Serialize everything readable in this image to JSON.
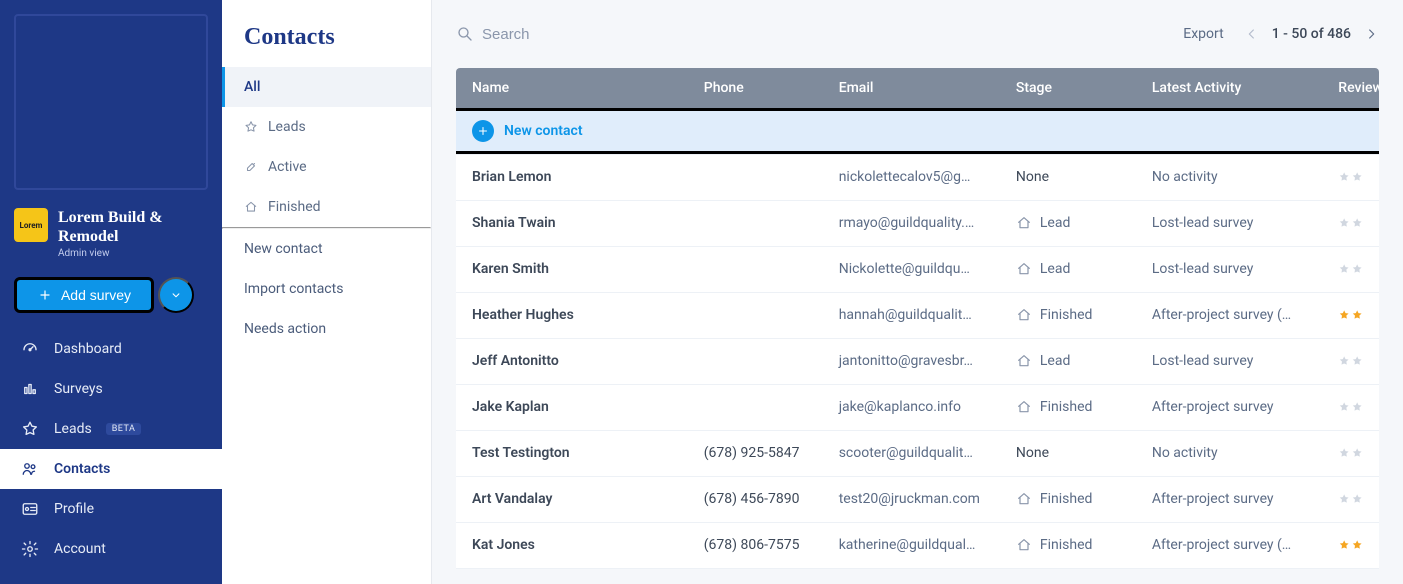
{
  "sidebar": {
    "company_name": "Lorem Build & Remodel",
    "admin_view": "Admin view",
    "avatar_label": "Lorem",
    "add_survey_label": "Add survey",
    "nav": [
      {
        "key": "dashboard",
        "label": "Dashboard",
        "icon": "gauge-icon"
      },
      {
        "key": "surveys",
        "label": "Surveys",
        "icon": "bar-chart-icon"
      },
      {
        "key": "leads",
        "label": "Leads",
        "icon": "star-icon",
        "badge": "BETA"
      },
      {
        "key": "contacts",
        "label": "Contacts",
        "icon": "people-icon",
        "active": true
      },
      {
        "key": "profile",
        "label": "Profile",
        "icon": "id-card-icon"
      },
      {
        "key": "account",
        "label": "Account",
        "icon": "gear-icon"
      }
    ]
  },
  "panel2": {
    "title": "Contacts",
    "filters": [
      {
        "key": "all",
        "label": "All",
        "active": true
      },
      {
        "key": "leads",
        "label": "Leads"
      },
      {
        "key": "active",
        "label": "Active"
      },
      {
        "key": "finished",
        "label": "Finished"
      }
    ],
    "actions": [
      {
        "key": "new",
        "label": "New contact"
      },
      {
        "key": "import",
        "label": "Import contacts"
      },
      {
        "key": "needs",
        "label": "Needs action"
      }
    ]
  },
  "topbar": {
    "search_placeholder": "Search",
    "export_label": "Export",
    "pager_text": "1 - 50 of 486"
  },
  "table": {
    "columns": {
      "name": "Name",
      "phone": "Phone",
      "email": "Email",
      "stage": "Stage",
      "activity": "Latest Activity",
      "review": "Review"
    },
    "new_contact_label": "New contact",
    "rows": [
      {
        "name": "Brian Lemon",
        "phone": "",
        "email": "nickolettecalov5@g…",
        "stage": "None",
        "activity": "No activity",
        "stars": 0
      },
      {
        "name": "Shania Twain",
        "phone": "",
        "email": "rmayo@guildquality.…",
        "stage": "Lead",
        "activity": "Lost-lead survey",
        "stars": 0
      },
      {
        "name": "Karen Smith",
        "phone": "",
        "email": "Nickolette@guildqu…",
        "stage": "Lead",
        "activity": "Lost-lead survey",
        "stars": 0
      },
      {
        "name": "Heather Hughes",
        "phone": "",
        "email": "hannah@guildqualit…",
        "stage": "Finished",
        "activity": "After-project survey (…",
        "stars": 2
      },
      {
        "name": "Jeff Antonitto",
        "phone": "",
        "email": "jantonitto@gravesbr…",
        "stage": "Lead",
        "activity": "Lost-lead survey",
        "stars": 0
      },
      {
        "name": "Jake Kaplan",
        "phone": "",
        "email": "jake@kaplanco.info",
        "stage": "Finished",
        "activity": "After-project survey",
        "stars": 0
      },
      {
        "name": "Test Testington",
        "phone": "(678) 925-5847",
        "email": "scooter@guildqualit…",
        "stage": "None",
        "activity": "No activity",
        "stars": 0
      },
      {
        "name": "Art Vandalay",
        "phone": "(678) 456-7890",
        "email": "test20@jruckman.com",
        "stage": "Finished",
        "activity": "After-project survey",
        "stars": 0
      },
      {
        "name": "Kat Jones",
        "phone": "(678) 806-7575",
        "email": "katherine@guildqual…",
        "stage": "Finished",
        "activity": "After-project survey (…",
        "stars": 2
      }
    ]
  }
}
